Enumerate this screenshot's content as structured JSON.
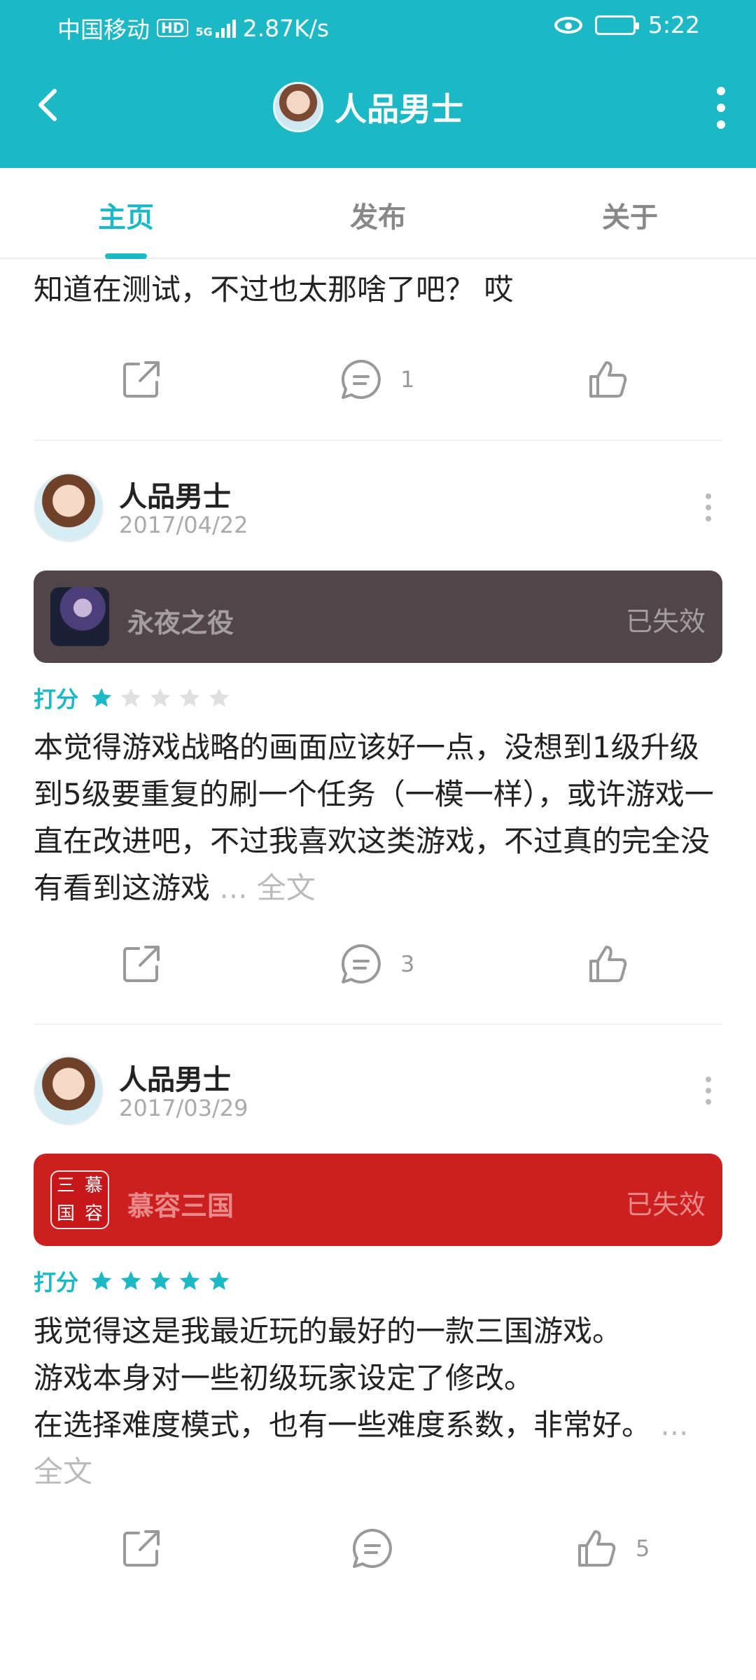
{
  "status_bar": {
    "carrier": "中国移动",
    "hd": "HD",
    "network": "5G",
    "speed": "2.87K/s",
    "time": "5:22"
  },
  "header": {
    "title": "人品男士"
  },
  "tabs": [
    {
      "label": "主页",
      "active": true
    },
    {
      "label": "发布",
      "active": false
    },
    {
      "label": "关于",
      "active": false
    }
  ],
  "posts": [
    {
      "text": "知道在测试，不过也太那啥了吧？ 哎",
      "comments": "1",
      "likes": ""
    },
    {
      "user": "人品男士",
      "date": "2017/04/22",
      "game": {
        "name": "永夜之役",
        "status": "已失效",
        "bg_color": "#514549"
      },
      "rating_label": "打分",
      "rating": 1,
      "text": "本觉得游戏战略的画面应该好一点，没想到1级升级到5级要重复的刷一个任务（一模一样），或许游戏一直在改进吧，不过我喜欢这类游戏，不过真的完全没有看到这游戏",
      "ellipsis": " ... ",
      "more_label": "全文",
      "comments": "3",
      "likes": ""
    },
    {
      "user": "人品男士",
      "date": "2017/03/29",
      "game": {
        "name": "慕容三国",
        "status": "已失效",
        "bg_color": "#cc2020",
        "icon_text": "三慕国容"
      },
      "rating_label": "打分",
      "rating": 5,
      "text_lines": [
        "我觉得这是我最近玩的最好的一款三国游戏。",
        "游戏本身对一些初级玩家设定了修改。",
        "在选择难度模式，也有一些难度系数，非常好。"
      ],
      "ellipsis": " ... ",
      "more_label": "全文",
      "comments": "",
      "likes": "5"
    }
  ],
  "colors": {
    "accent": "#1cb8c5",
    "star_filled": "#1cb8c5",
    "star_empty": "#e0e0e0"
  },
  "icons": [
    "back-icon",
    "more-icon",
    "share-icon",
    "comment-icon",
    "like-icon",
    "star-icon",
    "eye-icon",
    "battery-icon",
    "signal-icon"
  ]
}
